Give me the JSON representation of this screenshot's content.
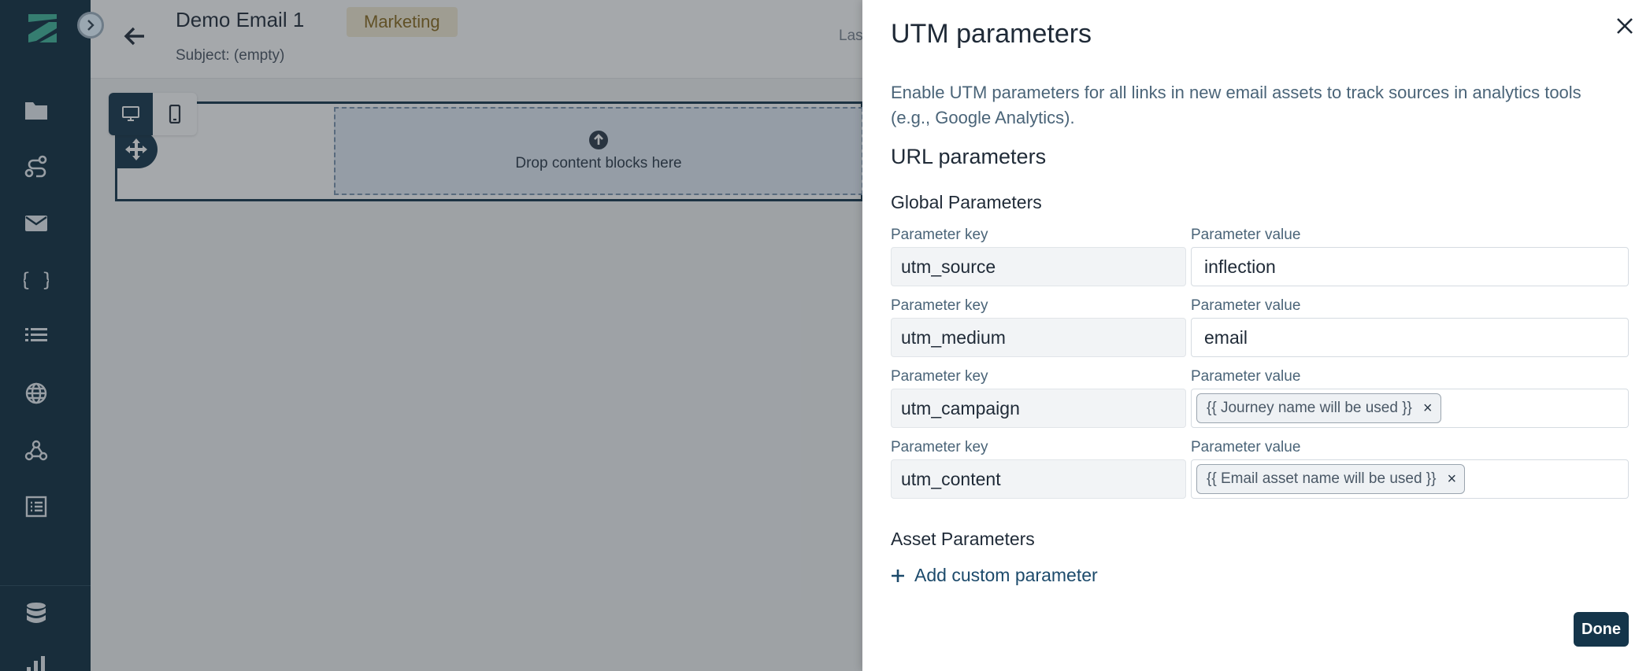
{
  "sidebar": {
    "logo": "inflection-logo",
    "items": [
      {
        "icon": "folder-icon"
      },
      {
        "icon": "journey-icon"
      },
      {
        "icon": "mail-icon"
      },
      {
        "icon": "braces-icon"
      },
      {
        "icon": "list-icon"
      },
      {
        "icon": "globe-icon"
      },
      {
        "icon": "webhook-icon"
      },
      {
        "icon": "document-list-icon"
      },
      {
        "icon": "database-icon"
      },
      {
        "icon": "bar-chart-icon"
      }
    ]
  },
  "editor": {
    "title": "Demo Email 1",
    "subject": "Subject: (empty)",
    "tag": "Marketing",
    "last_saved": "Las",
    "drop_label": "Drop content blocks here"
  },
  "drawer": {
    "title": "UTM parameters",
    "description": "Enable UTM parameters for all links in new email assets to track sources in analytics tools (e.g., Google Analytics).",
    "url_heading": "URL parameters",
    "global_heading": "Global Parameters",
    "params": [
      {
        "key_label": "Parameter key",
        "key": "utm_source",
        "value_label": "Parameter value",
        "value": "inflection"
      },
      {
        "key_label": "Parameter key",
        "key": "utm_medium",
        "value_label": "Parameter value",
        "value": "email"
      },
      {
        "key_label": "Parameter key",
        "key": "utm_campaign",
        "value_label": "Parameter value",
        "chip": "{{ Journey name will be used }}"
      },
      {
        "key_label": "Parameter key",
        "key": "utm_content",
        "value_label": "Parameter value",
        "chip": "{{ Email asset name will be used }}"
      }
    ],
    "chip_remove": "×",
    "asset_heading": "Asset Parameters",
    "add_custom": "Add custom parameter",
    "done": "Done"
  },
  "colors": {
    "sidebar_bg": "#0d2b3e",
    "accent": "#14354a",
    "link": "#1c4a6b"
  }
}
